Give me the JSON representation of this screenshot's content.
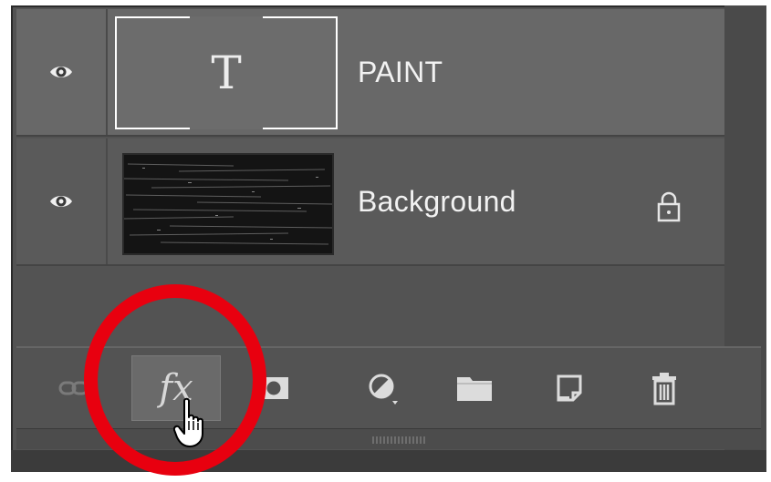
{
  "layers": [
    {
      "name": "PAINT",
      "type": "text",
      "thumbnail_glyph": "T",
      "visible": true,
      "selected": true,
      "icons": {
        "visibility": "eye-icon"
      }
    },
    {
      "name": "Background",
      "type": "image",
      "visible": true,
      "locked": true,
      "icons": {
        "visibility": "eye-icon",
        "lock": "lock-icon"
      }
    }
  ],
  "toolbar": {
    "fx_label": "fx",
    "tools": [
      {
        "icon": "link-layers-icon"
      },
      {
        "icon": "fx-icon"
      },
      {
        "icon": "layer-mask-icon"
      },
      {
        "icon": "adjustment-layer-icon"
      },
      {
        "icon": "group-folder-icon"
      },
      {
        "icon": "new-layer-icon"
      },
      {
        "icon": "trash-icon"
      }
    ]
  },
  "colors": {
    "panel": "#535353",
    "selected_row": "#686868",
    "annotation": "#e8000f"
  }
}
